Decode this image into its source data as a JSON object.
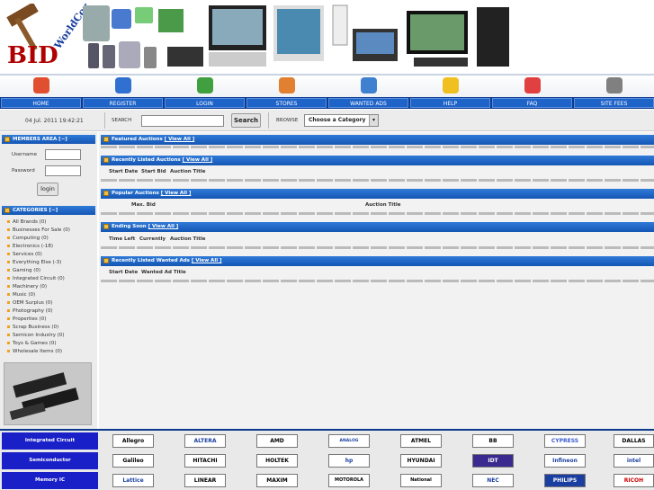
{
  "nav": {
    "items": [
      {
        "label": "HOME",
        "icon": "home-icon",
        "color": "#e05030"
      },
      {
        "label": "REGISTER",
        "icon": "register-icon",
        "color": "#3070d0"
      },
      {
        "label": "LOGIN",
        "icon": "login-icon",
        "color": "#40a040"
      },
      {
        "label": "STORES",
        "icon": "stores-icon",
        "color": "#e08030"
      },
      {
        "label": "WANTED ADS",
        "icon": "wanted-ads-icon",
        "color": "#4080d0"
      },
      {
        "label": "HELP",
        "icon": "help-icon",
        "color": "#f0c020"
      },
      {
        "label": "FAQ",
        "icon": "faq-icon",
        "color": "#e04040"
      },
      {
        "label": "SITE FEES",
        "icon": "site-fees-icon",
        "color": "#808080"
      }
    ]
  },
  "toolbar": {
    "date": "04 Jul. 2011 19:42:21",
    "search_label": "SEARCH",
    "search_button": "Search",
    "browse_label": "BROWSE",
    "browse_selected": "Choose a Category"
  },
  "members": {
    "title": "MEMBERS AREA [−]",
    "username_label": "Username",
    "password_label": "Password",
    "login_button": "login"
  },
  "categories": {
    "title": "CATEGORIES [−]",
    "items": [
      "All Brands (0)",
      "Businesses For Sale (0)",
      "Computing (0)",
      "Electronics (-18)",
      "Services (0)",
      "Everything Else (-3)",
      "Gaming (0)",
      "Integrated Circuit (0)",
      "Machinery (0)",
      "Music (0)",
      "OEM Surplus (0)",
      "Photography (0)",
      "Properties (0)",
      "Scrap Business (0)",
      "Semicon Industry (0)",
      "Toys & Games (0)",
      "Wholesale Items (0)"
    ]
  },
  "sections": {
    "featured": {
      "title": "Featured Auctions",
      "link": "[ View All ]"
    },
    "recent": {
      "title": "Recently Listed Auctions",
      "link": "[ View All ]",
      "cols": [
        "Start Date",
        "Start Bid",
        "Auction Title"
      ]
    },
    "popular": {
      "title": "Popular Auctions",
      "link": "[ View All ]",
      "cols": [
        "Max. Bid",
        "Auction Title"
      ]
    },
    "ending": {
      "title": "Ending Soon",
      "link": "[ View All ]",
      "cols": [
        "Time Left",
        "Currently",
        "Auction Title"
      ]
    },
    "wanted": {
      "title": "Recently Listed Wanted Ads",
      "link": "[ View All ]",
      "cols": [
        "Start Date",
        "Wanted Ad Title"
      ]
    }
  },
  "footer": {
    "rows": [
      {
        "label": "Integrated Circuit",
        "logos": [
          "Allegro",
          "ALTERA",
          "AMD",
          "ANALOG DEVICES",
          "ATMEL",
          "BB",
          "CYPRESS",
          "DALLAS"
        ]
      },
      {
        "label": "Semiconductor",
        "logos": [
          "Galileo",
          "HITACHI",
          "HOLTEK",
          "hp",
          "HYUNDAI",
          "IDT",
          "Infineon",
          "intel"
        ]
      },
      {
        "label": "Memory IC",
        "logos": [
          "Lattice",
          "LINEAR",
          "MAXIM",
          "MOTOROLA",
          "National",
          "NEC",
          "PHILIPS",
          "RICOH"
        ]
      }
    ]
  }
}
